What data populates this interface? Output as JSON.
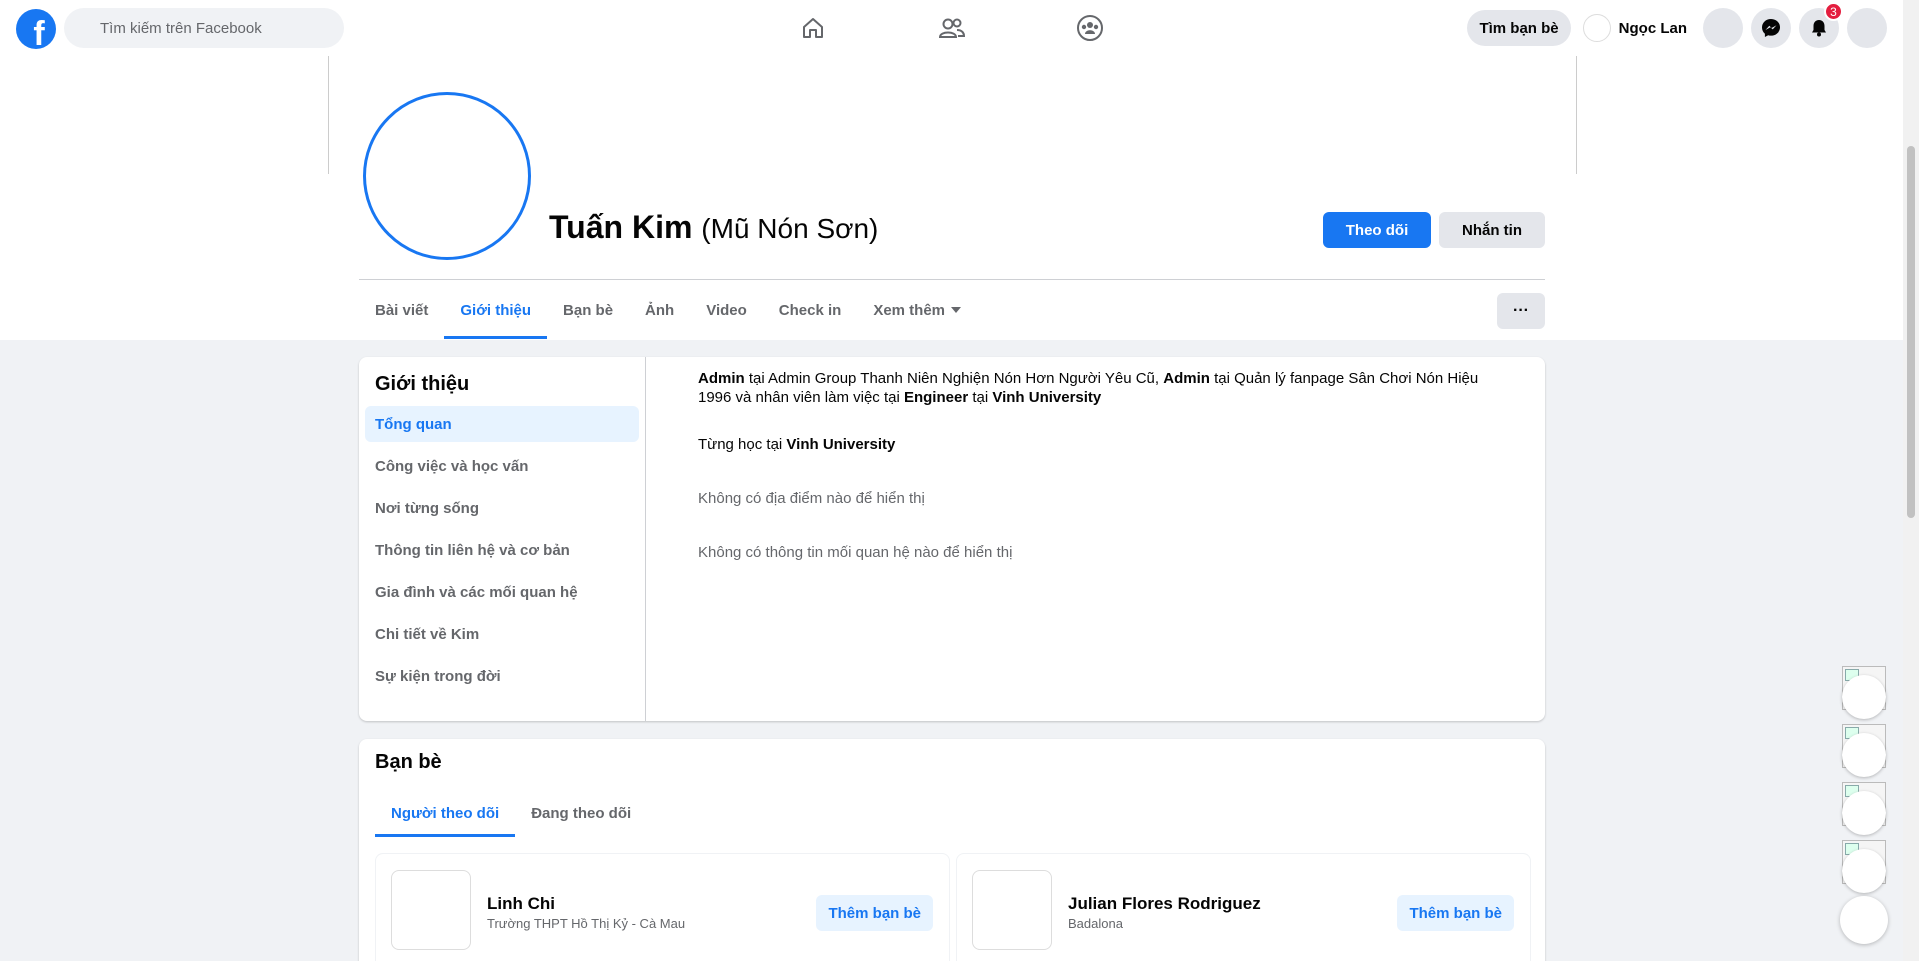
{
  "nav": {
    "search_placeholder": "Tìm kiếm trên Facebook",
    "find_friends": "Tìm bạn bè",
    "me_name": "Ngọc Lan",
    "notification_count": "3"
  },
  "profile": {
    "name": "Tuấn Kim",
    "alt_name": "(Mũ Nón Sơn)",
    "follow_label": "Theo dõi",
    "message_label": "Nhắn tin",
    "more_label": "···",
    "tabs": [
      "Bài viết",
      "Giới thiệu",
      "Bạn bè",
      "Ảnh",
      "Video",
      "Check in",
      "Xem thêm"
    ],
    "active_tab": "Giới thiệu"
  },
  "about": {
    "title": "Giới thiệu",
    "nav": [
      "Tổng quan",
      "Công việc và học vấn",
      "Nơi từng sống",
      "Thông tin liên hệ và cơ bản",
      "Gia đình và các mối quan hệ",
      "Chi tiết về Kim",
      "Sự kiện trong đời"
    ],
    "work": {
      "r1": "Admin",
      "t1": " tại Admin Group Thanh Niên Nghiện Nón Hơn Người Yêu Cũ, ",
      "r2": "Admin",
      "t2": " tại Quản lý fanpage Sân Chơi Nón Hiệu 1996 và nhân viên làm việc tại ",
      "r3": "Engineer",
      "t3": " tại ",
      "r4": "Vinh University"
    },
    "education": {
      "prefix": "Từng học tại ",
      "school": "Vinh University"
    },
    "no_places": "Không có địa điểm nào để hiển thị",
    "no_relationship": "Không có thông tin mối quan hệ nào để hiển thị"
  },
  "friends": {
    "title": "Bạn bè",
    "tabs": [
      "Người theo dõi",
      "Đang theo dõi"
    ],
    "add_label": "Thêm bạn bè",
    "items": [
      {
        "name": "Linh Chi",
        "sub": "Trường THPT Hồ Thị Kỷ - Cà Mau"
      },
      {
        "name": "Julian Flores Rodriguez",
        "sub": "Badalona"
      }
    ]
  },
  "colors": {
    "brand": "#1877f2",
    "badge": "#e41e3f",
    "page_bg": "#f0f2f5"
  },
  "icons": [
    "facebook-logo-icon",
    "search-icon",
    "home-icon",
    "friends-icon",
    "groups-icon",
    "menu-icon",
    "messenger-icon",
    "bell-icon",
    "account-icon",
    "caret-down-icon"
  ]
}
